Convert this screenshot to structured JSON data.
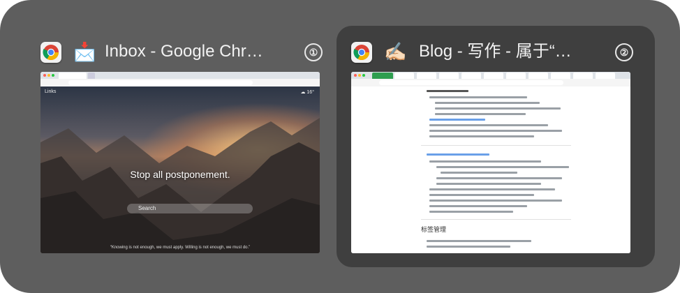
{
  "windows": [
    {
      "emoji": "📩",
      "title": "Inbox - Google Chr…",
      "number": "①",
      "app_icon": "chrome-icon",
      "preview": {
        "quote": "Stop all postponement.",
        "search_placeholder": "Search",
        "footer_quote": "“Knowing is not enough, we must apply. Willing is not enough, we must do.”",
        "top_left": "Links",
        "weather": "☁ 16°"
      }
    },
    {
      "emoji": "✍🏻",
      "title": "Blog - 写作 - 属于“…",
      "number": "②",
      "app_icon": "chrome-icon",
      "preview": {
        "heading": "标签管理"
      }
    }
  ],
  "selected_index": 1,
  "colors": {
    "switcher_bg": "#5e5e5e",
    "selection_bg": "#3f3f3f",
    "title_text": "#f2f2f2"
  }
}
